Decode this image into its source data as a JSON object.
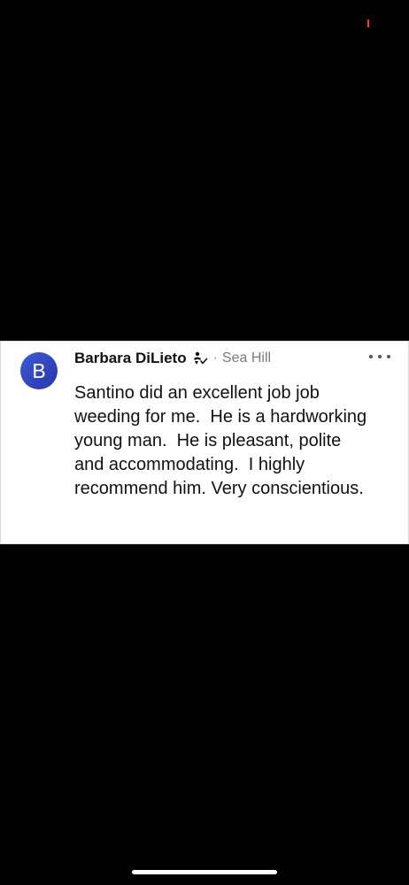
{
  "post": {
    "avatar_letter": "B",
    "author_name": "Barbara DiLieto",
    "badge_icon": "neighbor-badge-icon",
    "separator": "·",
    "location": "Sea Hill",
    "more_icon": "more-options-icon",
    "body": "Santino did an excellent job job weeding for me.  He is a hardworking young man.  He is pleasant, polite and accommodating.  I highly recommend him. Very conscientious."
  },
  "colors": {
    "avatar_bg": "#3b5bd6",
    "background": "#000000",
    "card": "#ffffff",
    "location_text": "#7a7a7a",
    "status_indicator": "#ff3b30"
  }
}
